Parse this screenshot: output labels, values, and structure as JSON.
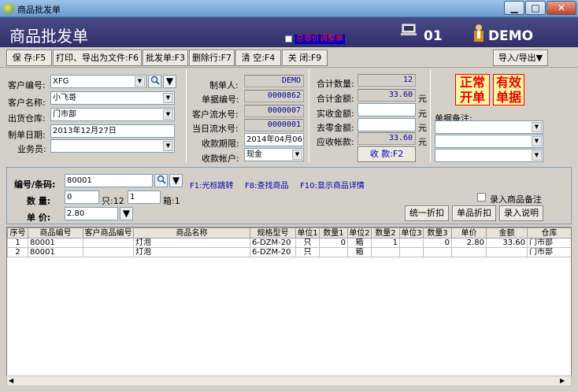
{
  "window": {
    "title": "商品批发单"
  },
  "header": {
    "title": "商品批发单",
    "link": "总零价调整单",
    "station": "01",
    "user": "DEMO"
  },
  "toolbar": {
    "buttons": [
      "保 存:F5",
      "打印、导出为文件:F6",
      "批发单:F3",
      "删除行:F7",
      "清 空:F4",
      "关 闭:F9"
    ],
    "import_export": "导入/导出▼"
  },
  "form": {
    "customer_code_label": "客户编号:",
    "customer_code": "XFG",
    "customer_name_label": "客户名称:",
    "customer_name": "小飞哥",
    "warehouse_label": "出货仓库:",
    "warehouse": "门市部",
    "date_label": "制单日期:",
    "date": "2013年12月27日",
    "salesman_label": "业务员:",
    "salesman": "",
    "maker_label": "制单人:",
    "maker": "DEMO",
    "doc_no_label": "单据编号:",
    "doc_no": "0000862",
    "cust_serial_label": "客户流水号:",
    "cust_serial": "0000007",
    "day_serial_label": "当日流水号:",
    "day_serial": "0000001",
    "due_label": "收款期限:",
    "due": "2014年04月06日",
    "account_label": "收款帐户:",
    "account": "现金",
    "total_qty_label": "合计数量:",
    "total_qty": "12",
    "total_amt_label": "合计金额:",
    "total_amt": "33.60",
    "received_label": "实收金额:",
    "received": "",
    "round_label": "去零金额:",
    "round": "",
    "receivable_label": "应收帐款:",
    "receivable": "33.60",
    "yuan": "元",
    "collect_button": "收 款:F2",
    "stamp1": "正常开单",
    "stamp2": "有效单据",
    "note_label": "单据备注:"
  },
  "entry": {
    "code_label": "编号/条码:",
    "code": "80001",
    "qty_label": "数  量:",
    "qty1": "0",
    "unit1": "只:12",
    "qty2": "1",
    "unit2": "箱:1",
    "price_label": "单  价:",
    "price": "2.80",
    "hint1": "F1:光标跳转",
    "hint2": "F8:查找商品",
    "hint3": "F10:显示商品详情",
    "note_check": "录入商品备注",
    "btn_discount_all": "统一折扣",
    "btn_discount": "单品折扣",
    "btn_desc": "录入说明"
  },
  "grid": {
    "headers": [
      "序号",
      "商品编号",
      "客户商品编号",
      "商品名称",
      "规格型号",
      "单位1",
      "数量1",
      "单位2",
      "数量2",
      "单位3",
      "数量3",
      "单价",
      "金额",
      "仓库"
    ],
    "rows": [
      [
        "1",
        "80001",
        "",
        "灯泡",
        "6-DZM-20",
        "只",
        "0",
        "箱",
        "1",
        "",
        "0",
        "2.80",
        "33.60",
        "门市部"
      ],
      [
        "2",
        "80001",
        "",
        "灯泡",
        "6-DZM-20",
        "只",
        "",
        "箱",
        "",
        "",
        "",
        "",
        "",
        "门市部"
      ]
    ]
  },
  "colors": {
    "header_bg": "#2f2f6a",
    "stamp_red": "#e00000"
  }
}
